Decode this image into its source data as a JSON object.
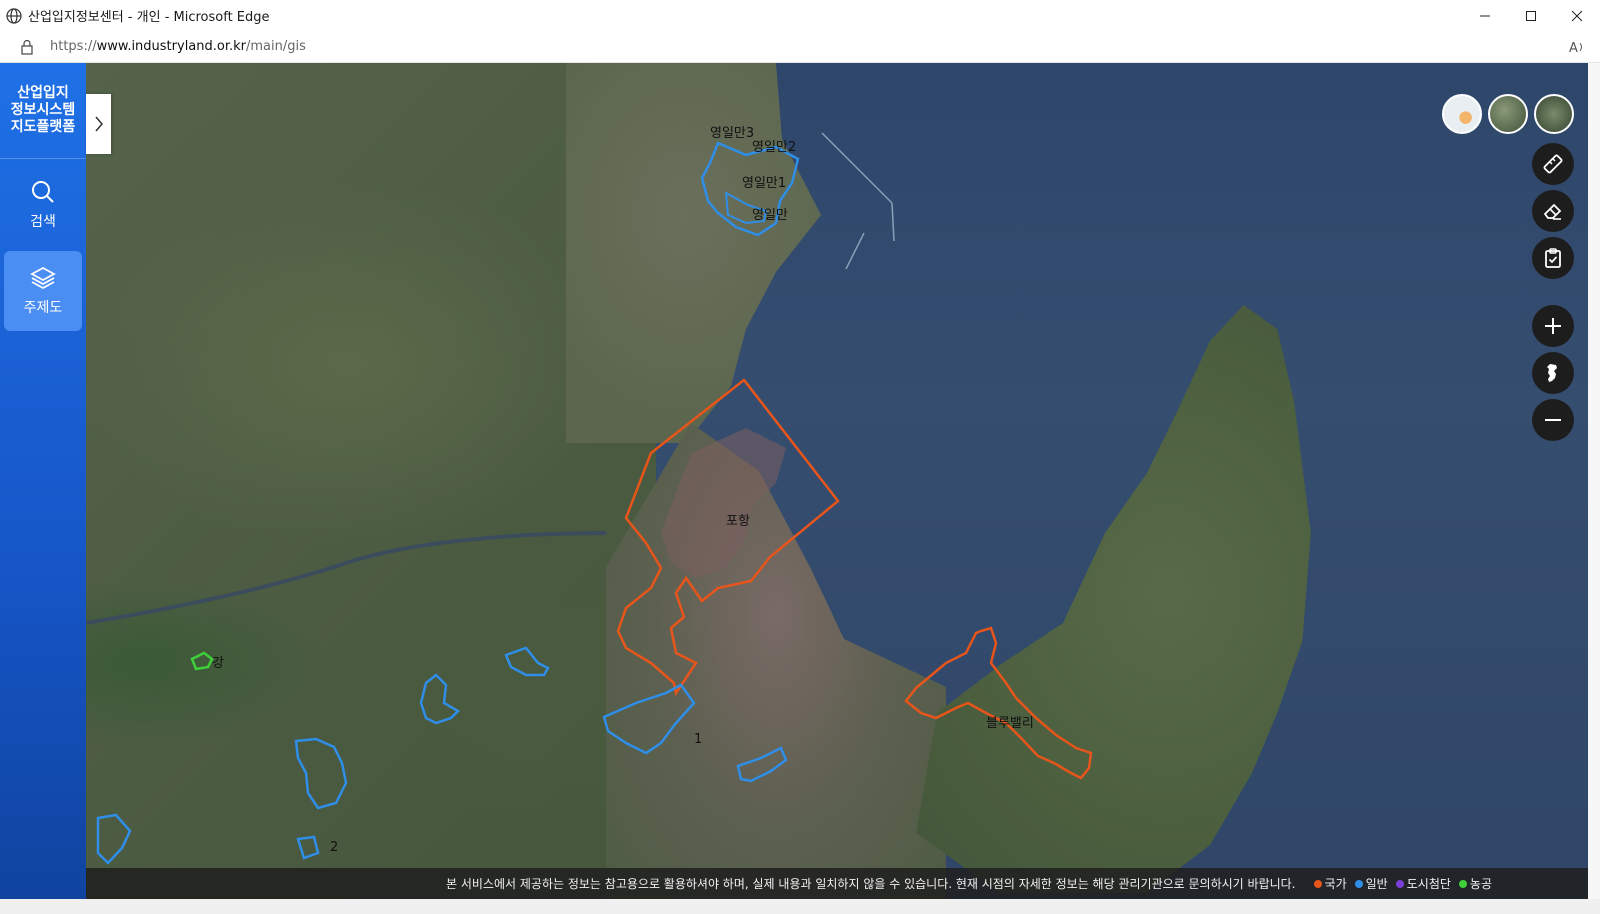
{
  "window": {
    "title": "산업입지정보센터 - 개인 - Microsoft Edge",
    "url_prefix": "https://",
    "url_domain": "www.industryland.or.kr",
    "url_path": "/main/gis"
  },
  "sidebar": {
    "brand_lines": [
      "산업입지",
      "정보시스템",
      "지도플랫폼"
    ],
    "items": [
      {
        "label": "검색",
        "icon": "search-icon"
      },
      {
        "label": "주제도",
        "icon": "layers-icon",
        "active": true
      }
    ]
  },
  "map": {
    "labels": [
      {
        "text": "영일만3"
      },
      {
        "text": "영일만2"
      },
      {
        "text": "영일만1"
      },
      {
        "text": "영일만"
      },
      {
        "text": "포항"
      },
      {
        "text": "블루밸리"
      },
      {
        "text": "강"
      },
      {
        "text": "1"
      },
      {
        "text": "2"
      }
    ],
    "colors": {
      "national": "#e8551a",
      "general": "#2f8ee8",
      "urban_hightech": "#7a3fd6",
      "agri": "#3fcf3a"
    }
  },
  "tools": {
    "basemaps": [
      "street-map",
      "satellite-map",
      "hybrid-map"
    ],
    "buttons": [
      "ruler-icon",
      "eraser-icon",
      "clipboard-check-icon",
      "zoom-in-icon",
      "korea-map-icon",
      "zoom-out-icon"
    ]
  },
  "footer": {
    "notice": "본 서비스에서 제공하는 정보는 참고용으로 활용하셔야 하며, 실제 내용과 일치하지 않을 수 있습니다. 현재 시점의 자세한 정보는 해당 관리기관으로 문의하시기 바랍니다.",
    "legend": [
      {
        "label": "국가",
        "color": "#e8551a"
      },
      {
        "label": "일반",
        "color": "#2f8ee8"
      },
      {
        "label": "도시첨단",
        "color": "#7a3fd6"
      },
      {
        "label": "농공",
        "color": "#3fcf3a"
      }
    ]
  }
}
